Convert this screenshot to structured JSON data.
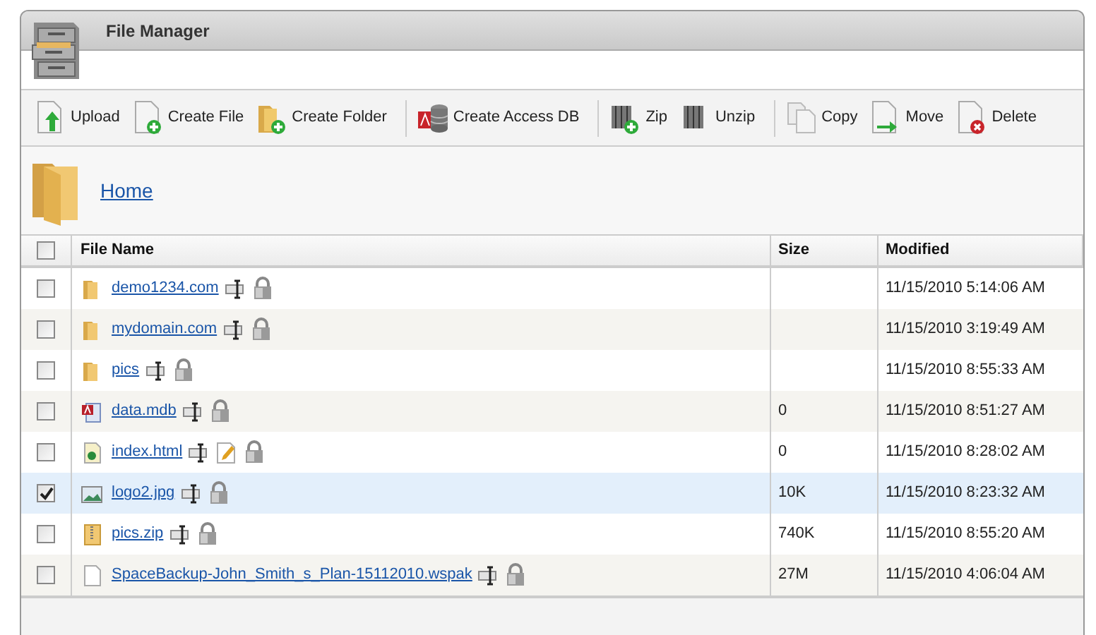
{
  "window": {
    "title": "File Manager"
  },
  "toolbar_groups": [
    {
      "items": [
        {
          "label": "Upload",
          "kind": "upload"
        },
        {
          "label": "Create File",
          "kind": "newfile"
        },
        {
          "label": "Create Folder",
          "kind": "newfolder"
        }
      ]
    },
    {
      "items": [
        {
          "label": "Create Access DB",
          "kind": "db"
        }
      ]
    },
    {
      "items": [
        {
          "label": "Zip",
          "kind": "zip"
        },
        {
          "label": "Unzip",
          "kind": "unzip"
        }
      ]
    },
    {
      "items": [
        {
          "label": "Copy",
          "kind": "copy"
        },
        {
          "label": "Move",
          "kind": "move"
        },
        {
          "label": "Delete",
          "kind": "delete"
        }
      ]
    }
  ],
  "breadcrumb": {
    "label": "Home"
  },
  "table": {
    "columns": [
      "File Name",
      "Size",
      "Modified"
    ],
    "all_checked": false,
    "rows": [
      {
        "name": "demo1234.com",
        "kind": "folder",
        "size": "",
        "modified": "11/15/2010 5:14:06 AM",
        "checked": false,
        "editable": false
      },
      {
        "name": "mydomain.com",
        "kind": "folder",
        "size": "",
        "modified": "11/15/2010 3:19:49 AM",
        "checked": false,
        "editable": false
      },
      {
        "name": "pics",
        "kind": "folder",
        "size": "",
        "modified": "11/15/2010 8:55:33 AM",
        "checked": false,
        "editable": false
      },
      {
        "name": "data.mdb",
        "kind": "db",
        "size": "0",
        "modified": "11/15/2010 8:51:27 AM",
        "checked": false,
        "editable": false
      },
      {
        "name": "index.html",
        "kind": "html",
        "size": "0",
        "modified": "11/15/2010 8:28:02 AM",
        "checked": false,
        "editable": true
      },
      {
        "name": "logo2.jpg",
        "kind": "image",
        "size": "10K",
        "modified": "11/15/2010 8:23:32 AM",
        "checked": true,
        "editable": false
      },
      {
        "name": "pics.zip",
        "kind": "zip",
        "size": "740K",
        "modified": "11/15/2010 8:55:20 AM",
        "checked": false,
        "editable": false
      },
      {
        "name": "SpaceBackup-John_Smith_s_Plan-15112010.wspak",
        "kind": "file",
        "size": "27M",
        "modified": "11/15/2010 4:06:04 AM",
        "checked": false,
        "editable": false
      }
    ]
  }
}
